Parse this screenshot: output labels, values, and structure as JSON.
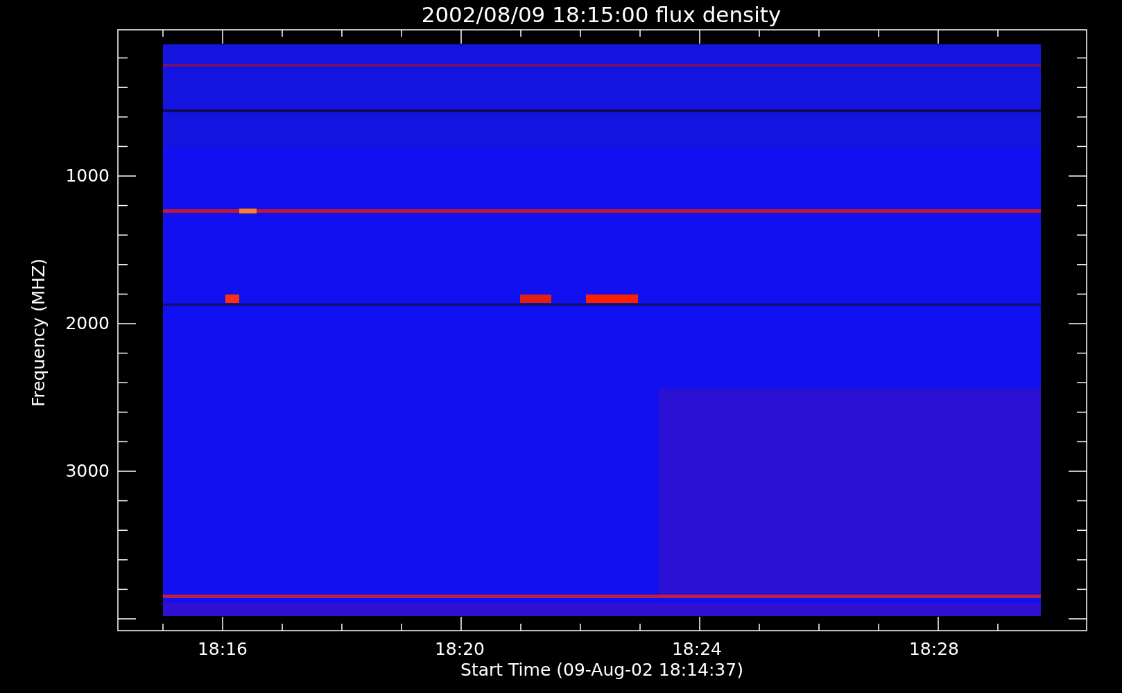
{
  "plot": {
    "title": "2002/08/09 18:15:00 flux density",
    "xlabel": "Start Time (09-Aug-02 18:14:37)",
    "ylabel": "Frequency (MHZ)",
    "x_tick_labels": [
      "18:16",
      "18:20",
      "18:24",
      "18:28"
    ],
    "y_tick_labels": [
      "1000",
      "2000",
      "3000"
    ]
  }
}
